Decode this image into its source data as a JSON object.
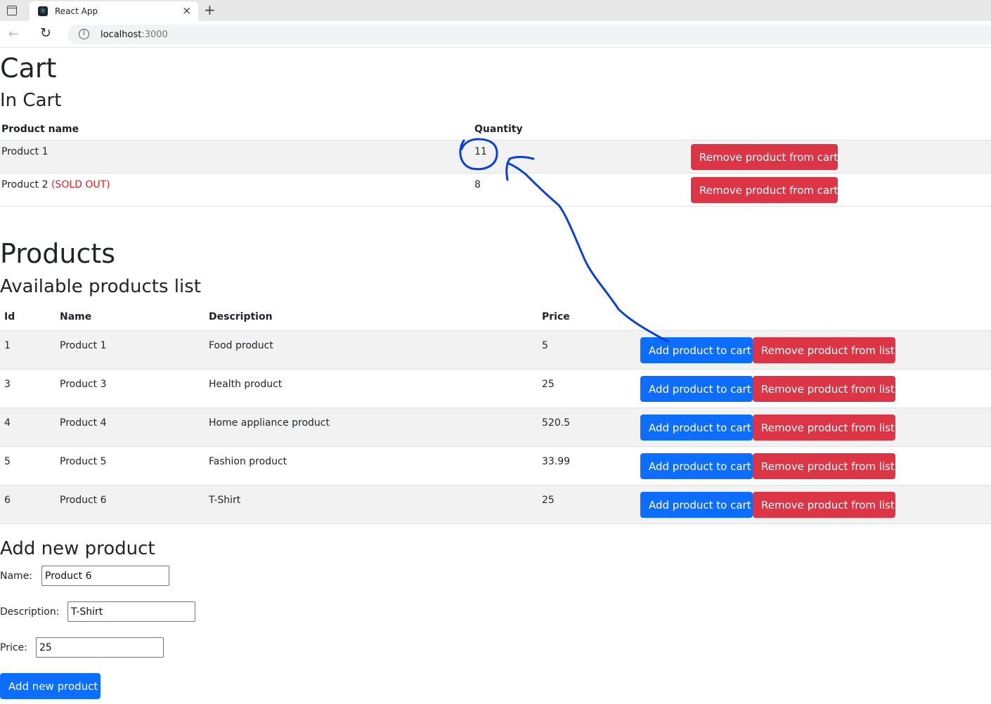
{
  "browser": {
    "tab_title": "React App",
    "tab_close": "×",
    "new_tab": "+",
    "url_host": "localhost",
    "url_port": ":3000",
    "back": "←",
    "reload": "↻",
    "info": "i"
  },
  "cart": {
    "title": "Cart",
    "subtitle": "In Cart",
    "headers": {
      "name": "Product name",
      "quantity": "Quantity"
    },
    "rows": [
      {
        "name": "Product 1",
        "sold_out": "",
        "quantity": "11",
        "remove_label": "Remove product from cart"
      },
      {
        "name": "Product 2",
        "sold_out": "(SOLD OUT)",
        "quantity": "8",
        "remove_label": "Remove product from cart"
      }
    ]
  },
  "products": {
    "title": "Products",
    "subtitle": "Available products list",
    "headers": {
      "id": "Id",
      "name": "Name",
      "description": "Description",
      "price": "Price"
    },
    "add_label": "Add product to cart",
    "remove_label": "Remove product from list",
    "rows": [
      {
        "id": "1",
        "name": "Product 1",
        "description": "Food product",
        "price": "5"
      },
      {
        "id": "3",
        "name": "Product 3",
        "description": "Health product",
        "price": "25"
      },
      {
        "id": "4",
        "name": "Product 4",
        "description": "Home appliance product",
        "price": "520.5"
      },
      {
        "id": "5",
        "name": "Product 5",
        "description": "Fashion product",
        "price": "33.99"
      },
      {
        "id": "6",
        "name": "Product 6",
        "description": "T-Shirt",
        "price": "25"
      }
    ]
  },
  "add_form": {
    "title": "Add new product",
    "name_label": "Name:",
    "name_value": "Product 6",
    "description_label": "Description:",
    "description_value": "T-Shirt",
    "price_label": "Price:",
    "price_value": "25",
    "submit_label": "Add new product"
  },
  "annotation": {
    "color": "#0a3fdc"
  }
}
